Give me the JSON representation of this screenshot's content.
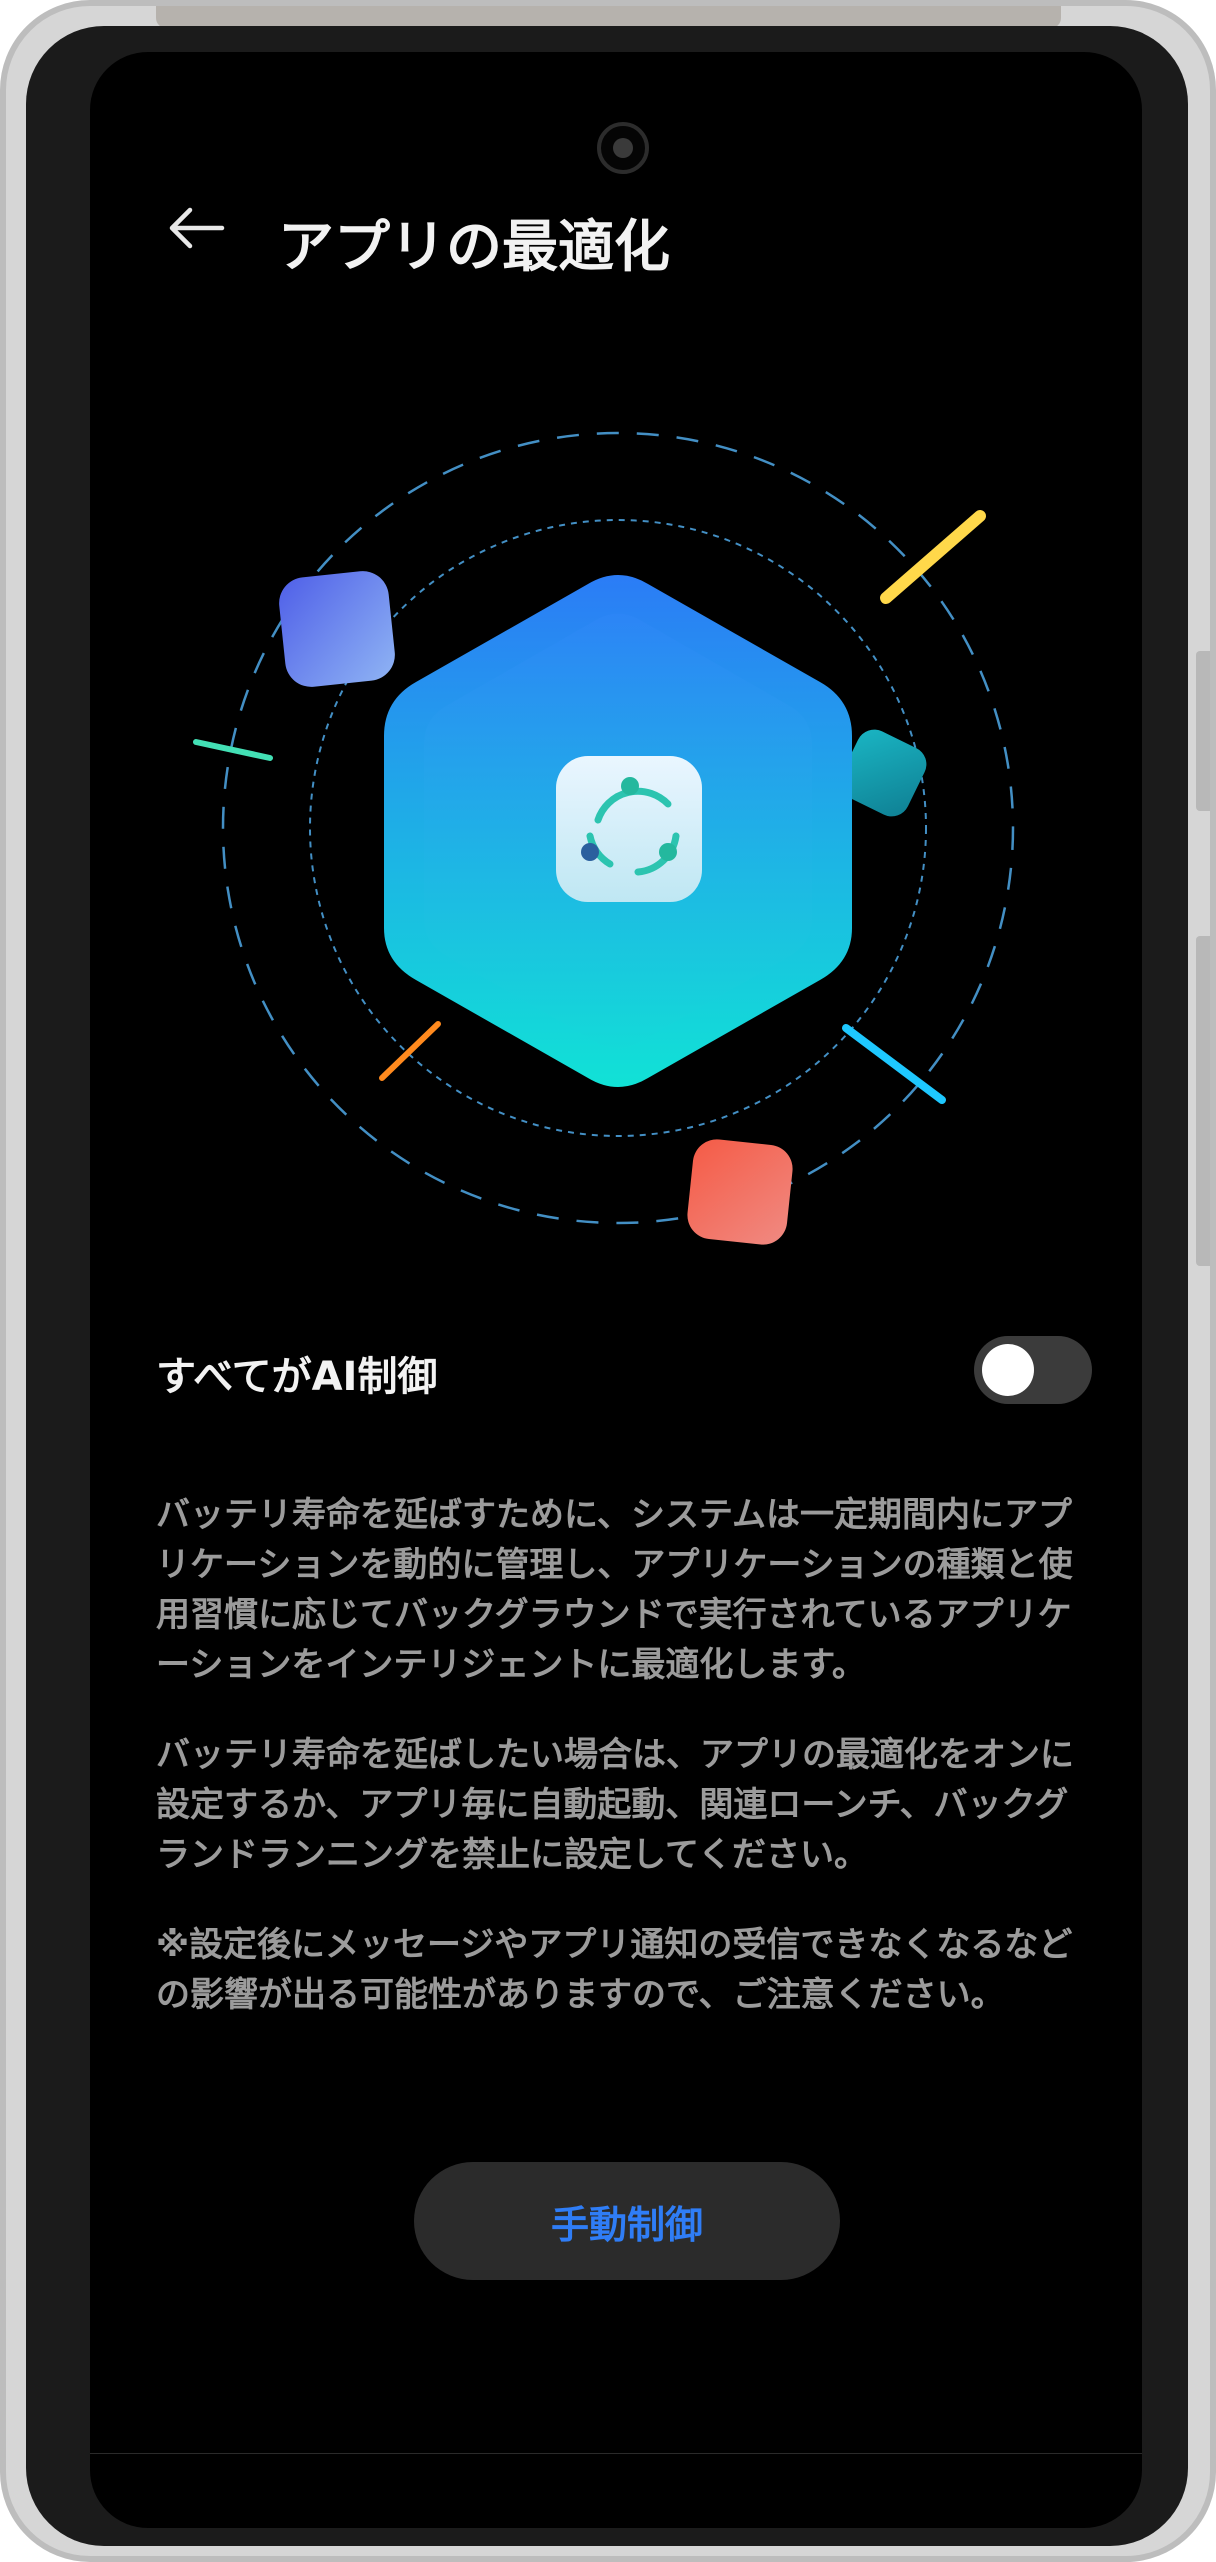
{
  "header": {
    "title": "アプリの最適化",
    "back_icon": "arrow-left-icon"
  },
  "illustration": {
    "center_icon": "app-cycle-icon",
    "hexagon_gradient": [
      "#2b7cf6",
      "#11e2d6"
    ],
    "tile_colors": {
      "purple": "#5a6ef0",
      "teal": "#1fc4c8",
      "red": "#f0664f"
    },
    "accent_colors": {
      "yellow": "#ffd84a",
      "green": "#43e0b5",
      "orange": "#ff8a1e",
      "cyan": "#1ec8ff"
    },
    "orbit_color": "#4a9fd9"
  },
  "ai_control": {
    "label": "すべてがAI制御",
    "enabled": false
  },
  "description": {
    "paragraphs": [
      "バッテリ寿命を延ばすために、システムは一定期間内にアプリケーションを動的に管理し、アプリケーションの種類と使用習慣に応じてバックグラウンドで実行されているアプリケーションをインテリジェントに最適化します。",
      "バッテリ寿命を延ばしたい場合は、アプリの最適化をオンに設定するか、アプリ毎に自動起動、関連ローンチ、バックグランドランニングを禁止に設定してください。",
      "※設定後にメッセージやアプリ通知の受信できなくなるなどの影響が出る可能性がありますので、ご注意ください。"
    ]
  },
  "manual_button": {
    "label": "手動制御",
    "color": "#2f7df6"
  }
}
